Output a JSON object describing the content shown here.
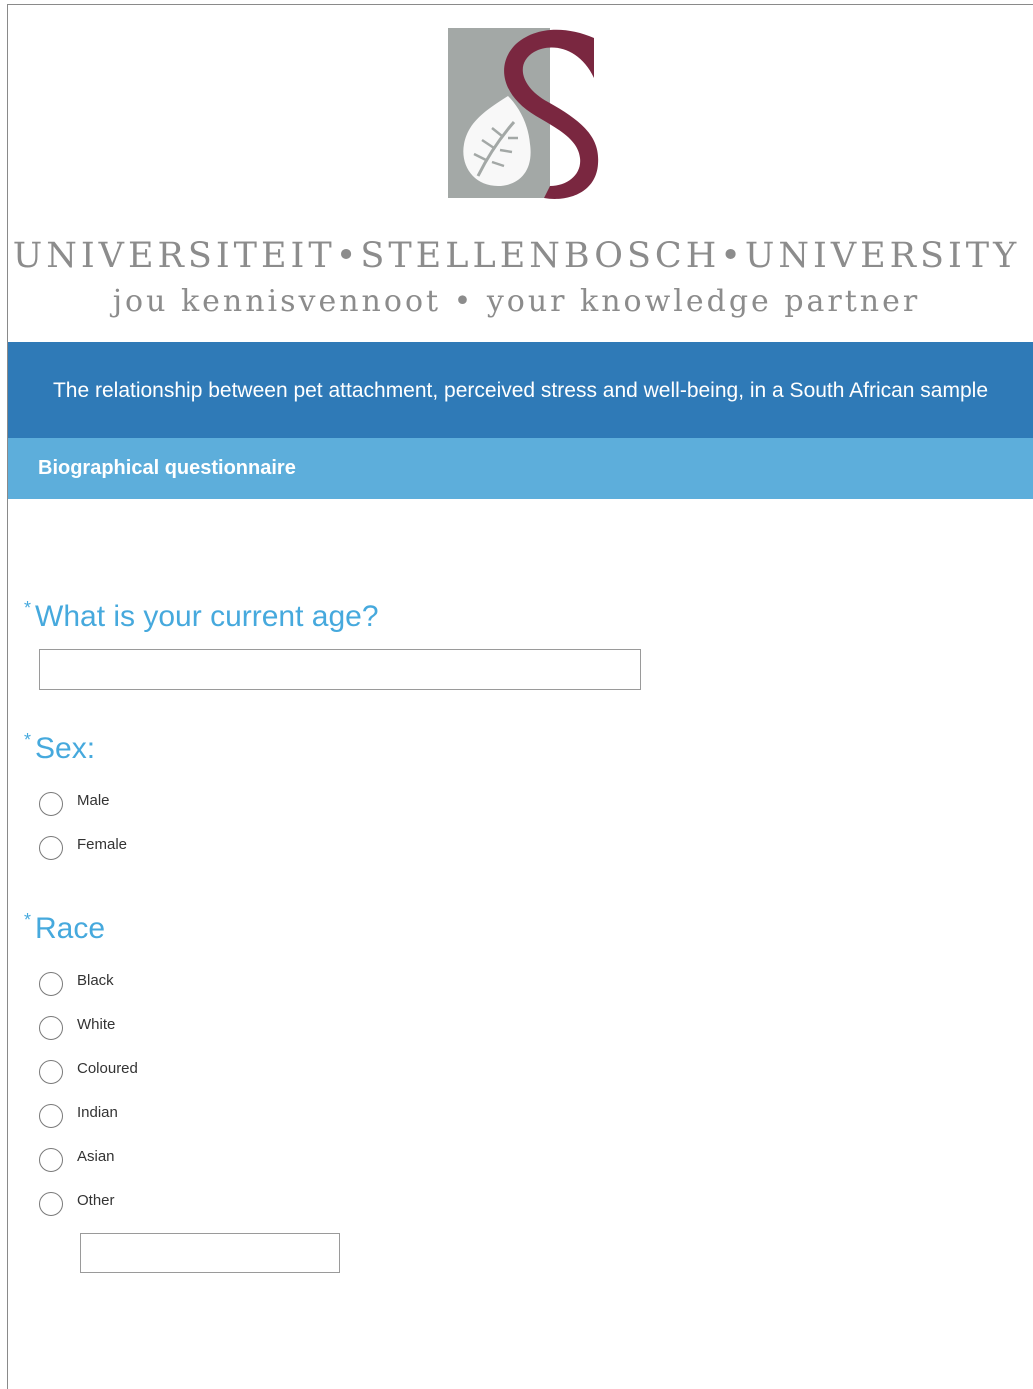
{
  "header": {
    "university_name": "UNIVERSITEIT•STELLENBOSCH•UNIVERSITY",
    "tagline": "jou kennisvennoot • your knowledge partner",
    "logo_icon": "stellenbosch-s-oak-leaf-logo"
  },
  "survey": {
    "title": "The relationship between pet attachment, perceived stress and well-being, in a South African sample",
    "section": "Biographical questionnaire"
  },
  "questions": {
    "age": {
      "required_mark": "*",
      "label": "What is your current age?",
      "value": ""
    },
    "sex": {
      "required_mark": "*",
      "label": "Sex:",
      "options": [
        "Male",
        "Female"
      ]
    },
    "race": {
      "required_mark": "*",
      "label": "Race",
      "options": [
        "Black",
        "White",
        "Coloured",
        "Indian",
        "Asian",
        "Other"
      ],
      "other_value": ""
    }
  },
  "colors": {
    "title_bar": "#2f7ab7",
    "section_bar": "#5daedb",
    "question_text": "#46a9dd",
    "logo_maroon": "#7a2740",
    "logo_grey": "#a3a8a6"
  }
}
